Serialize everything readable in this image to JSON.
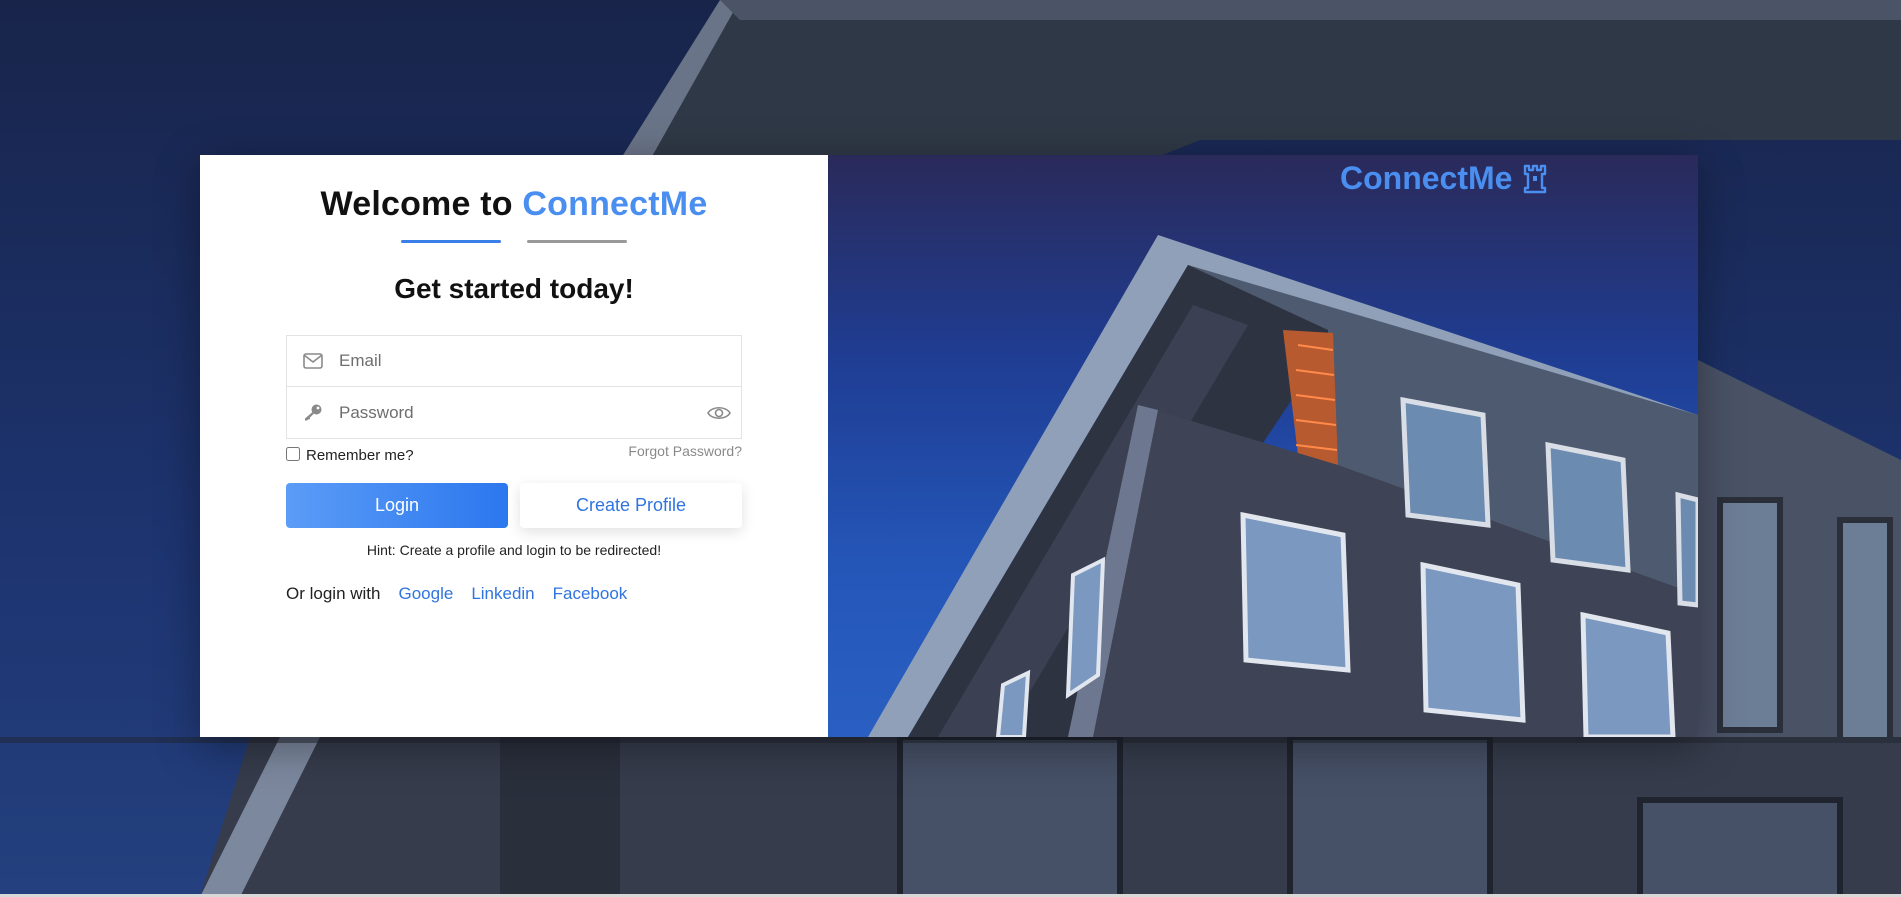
{
  "welcome": {
    "prefix": "Welcome to",
    "brand": "ConnectMe"
  },
  "subtitle": "Get started today!",
  "form": {
    "email_placeholder": "Email",
    "password_placeholder": "Password",
    "remember_label": "Remember me?",
    "forgot_label": "Forgot Password?"
  },
  "buttons": {
    "login_label": "Login",
    "create_label": "Create Profile"
  },
  "hint": "Hint: Create a profile and login to be redirected!",
  "social": {
    "label": "Or login with",
    "providers": [
      "Google",
      "Linkedin",
      "Facebook"
    ]
  },
  "logo": {
    "text": "ConnectMe",
    "icon": "castle-icon"
  },
  "icons": {
    "email": "envelope-icon",
    "password": "key-icon",
    "toggle_visibility": "eye-icon"
  },
  "colors": {
    "accent": "#4a8ef0",
    "link": "#2f74e0",
    "login_gradient_start": "#5b9cf7",
    "login_gradient_end": "#2b77ee",
    "tab_active": "#3a7ee8",
    "tab_inactive": "#999999"
  }
}
